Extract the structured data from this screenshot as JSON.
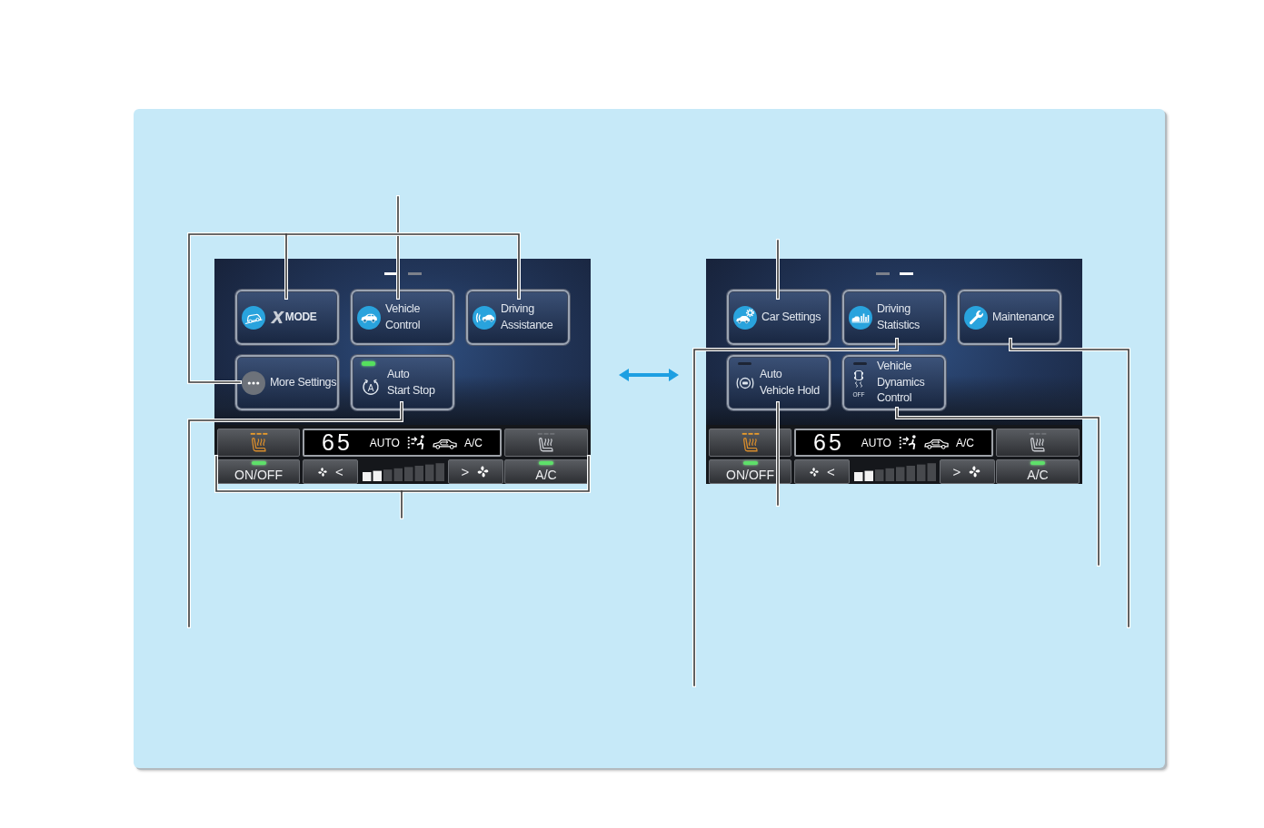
{
  "screens": [
    {
      "pages": [
        {
          "selected": true
        },
        {
          "selected": false
        }
      ],
      "tiles": [
        {
          "kind": "xmode",
          "logo": "X",
          "label": [
            "MODE"
          ]
        },
        {
          "kind": "vehicle-control",
          "label": [
            "Vehicle",
            "Control"
          ]
        },
        {
          "kind": "driving-assistance",
          "label": [
            "Driving",
            "Assistance"
          ]
        },
        {
          "kind": "more-settings",
          "label": [
            "More Settings"
          ]
        },
        {
          "kind": "auto-start-stop",
          "icon_text": "A",
          "label": [
            "Auto",
            "Start Stop"
          ],
          "lamp_on": true
        }
      ],
      "climate": {
        "seat_heaters": [
          {
            "on": true
          },
          {
            "on": false
          }
        ],
        "temperature": "65",
        "mode": "AUTO",
        "ac_status": "A/C",
        "power": {
          "label": "ON/OFF",
          "lamp_on": true
        },
        "fan_down": {
          "label": "<"
        },
        "fan": {
          "level": 0.25
        },
        "fan_up": {
          "label": ">"
        },
        "ac": {
          "label": "A/C",
          "lamp_on": true
        }
      }
    },
    {
      "pages": [
        {
          "selected": false
        },
        {
          "selected": true
        }
      ],
      "tiles": [
        {
          "kind": "car-settings",
          "label": [
            "Car Settings"
          ]
        },
        {
          "kind": "driving-statistics",
          "label": [
            "Driving",
            "Statistics"
          ]
        },
        {
          "kind": "maintenance",
          "label": [
            "Maintenance"
          ]
        },
        {
          "kind": "auto-vehicle-hold",
          "label": [
            "Auto",
            "Vehicle Hold"
          ],
          "lamp_on": false
        },
        {
          "kind": "vehicle-dynamics",
          "icon_text": "OFF",
          "label": [
            "Vehicle",
            "Dynamics",
            "Control"
          ],
          "lamp_on": false
        }
      ],
      "climate": {
        "seat_heaters": [
          {
            "on": true
          },
          {
            "on": false
          }
        ],
        "temperature": "65",
        "mode": "AUTO",
        "ac_status": "A/C",
        "power": {
          "label": "ON/OFF",
          "lamp_on": true
        },
        "fan_down": {
          "label": "<"
        },
        "fan": {
          "level": 0.25
        },
        "fan_up": {
          "label": ">"
        },
        "ac": {
          "label": "A/C",
          "lamp_on": true
        }
      }
    }
  ]
}
